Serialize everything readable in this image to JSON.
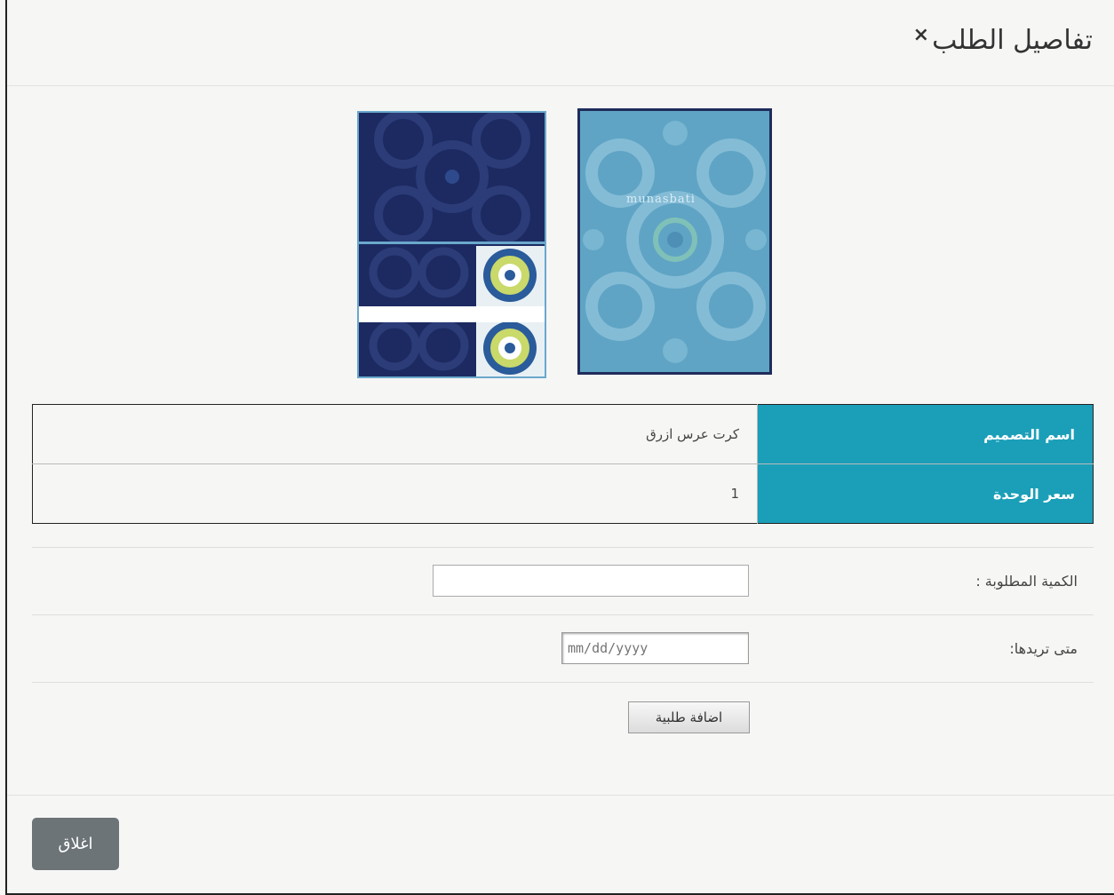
{
  "modal": {
    "title": "تفاصيل الطلب",
    "close_icon": "×"
  },
  "cards": {
    "front_brand": "munasbati",
    "back_label": "card-back-pattern",
    "colors": {
      "navy": "#1c2a61",
      "teal": "#5fa4c4",
      "lime": "#c9d96a"
    }
  },
  "details": [
    {
      "label": "اسم التصميم",
      "value": "كرت عرس ازرق"
    },
    {
      "label": "سعر الوحدة",
      "value": "1"
    }
  ],
  "form": {
    "quantity_label": "الكمية المطلوبة :",
    "quantity_value": "",
    "date_label": "متى تريدها:",
    "date_placeholder": "mm/dd/yyyy",
    "add_button": "اضافة طلبية"
  },
  "footer": {
    "close_button": "اغلاق"
  },
  "accent_color": "#1b9fb8"
}
